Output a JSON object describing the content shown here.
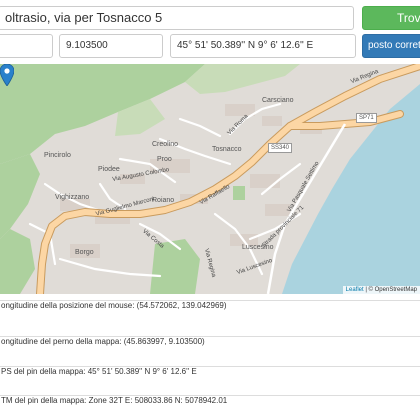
{
  "search": {
    "address_value": "oltrasio, via per Tosnacco 5",
    "find_label": "Trova"
  },
  "coords": {
    "lat_value": "",
    "lng_value": "9.103500",
    "gps_value": "45° 51' 50.389'' N    9° 6' 12.6'' E",
    "correct_label": "posto corretto v"
  },
  "map": {
    "places": {
      "carsciano": "Carsciano",
      "tosnacco": "Tosnacco",
      "creolino": "Creolino",
      "proo": "Proo",
      "piodee": "Piodee",
      "pincirolo": "Pincirolo",
      "vighizzano": "Vighizzano",
      "roiano": "Roiano",
      "borgo": "Borgo",
      "luscesino": "Luscesino"
    },
    "roads": {
      "regina_top": "Via Regina",
      "sp71": "SP71",
      "ss340": "SS340",
      "via_raffaello": "Via Raffaello",
      "via_roma": "Via Roma",
      "via_guglielmo": "Via Guglielmo Marconi",
      "via_augusto": "Via Augusto Colombo",
      "via_costa": "Via Costa",
      "via_regina_left": "Via Regina",
      "strada_seven": "Strada provinciale 71",
      "via_luscesino": "Via Luscesino",
      "via_della_torre": "Via Pasquale Settimo"
    },
    "colors": {
      "water": "#aad3df",
      "land": "#e0dcd7",
      "forest": "#add19e",
      "road_primary": "#fcd6a4",
      "road_primary_casing": "#c99b5e",
      "marker": "#2a81cb"
    },
    "attribution_link": "Leaflet",
    "attribution_rest": "| © OpenStreetMap"
  },
  "info": {
    "mouse_latlng": "ongitudine della posizione del mouse: (54.572062, 139.042969)",
    "pin_latlng": "ongitudine del perno della mappa: (45.863997, 9.103500)",
    "gps_pin": "PS del pin della mappa: 45° 51' 50.389'' N 9° 6' 12.6'' E",
    "utm_pin": "TM del pin della mappa: Zone 32T E: 508033.86 N: 5078942.01"
  }
}
